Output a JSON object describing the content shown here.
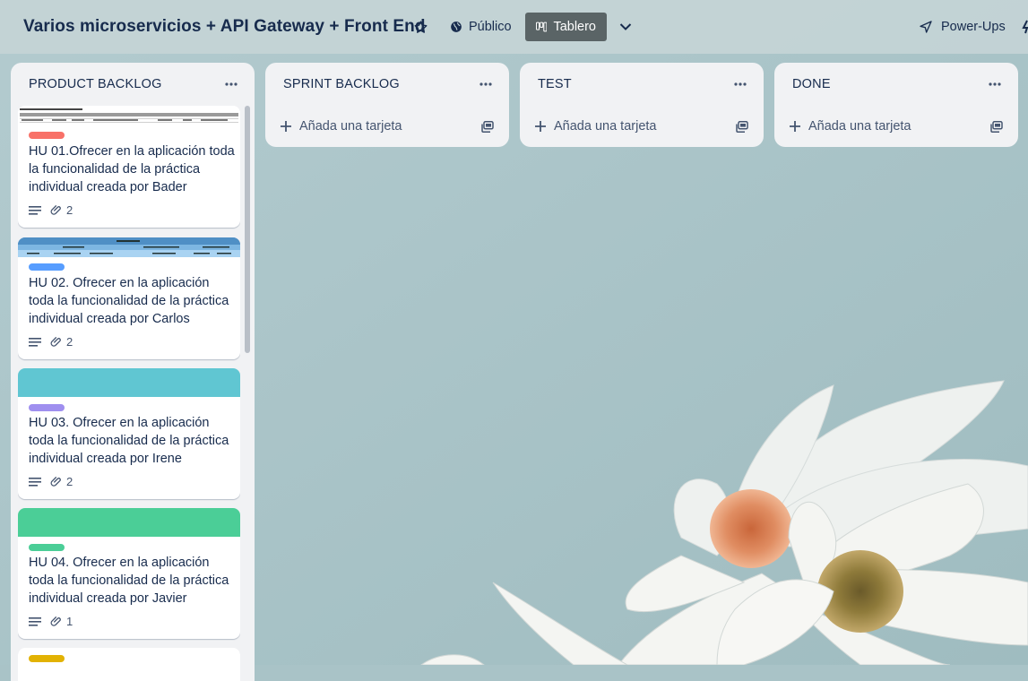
{
  "board": {
    "title": "Varios microservicios + API Gateway + Front End",
    "visibility": "Público",
    "view": "Tablero",
    "powerups": "Power-Ups"
  },
  "icons": {
    "star": "star-icon",
    "visibility": "globe-icon",
    "view": "board-icon",
    "chevron": "chevron-down-icon",
    "powerups": "rocket-icon",
    "menu": "more-icon",
    "add": "plus-icon",
    "template": "card-template-icon",
    "description": "description-icon",
    "attachment": "paperclip-icon"
  },
  "colors": {
    "header_bg": "#c4d4d6",
    "list_bg": "#f1f2f4",
    "view_button_bg": "#5a6466",
    "text": "#172b4d"
  },
  "lists": [
    {
      "title": "PRODUCT BACKLOG",
      "cards": [
        {
          "title": "HU 01.Ofrecer en la aplicación toda la funcionalidad de la práctica individual creada por Bader",
          "label_color": "#f87168",
          "cover": "document",
          "attachments": "2"
        },
        {
          "title": "HU 02. Ofrecer en la aplicación toda la funcionalidad de la práctica individual creada por Carlos",
          "label_color": "#579dff",
          "cover": "spreadsheet",
          "attachments": "2"
        },
        {
          "title": "HU 03. Ofrecer en la aplicación toda la funcionalidad de la práctica individual creada por Irene",
          "label_color": "#9f8fef",
          "cover_color": "#60c6d2",
          "attachments": "2"
        },
        {
          "title": "HU 04. Ofrecer en la aplicación toda la funcionalidad de la práctica individual creada por Javier",
          "label_color": "#4bce97",
          "cover_color": "#4bce97",
          "attachments": "1"
        },
        {
          "title": "",
          "label_color": "#e2b203"
        }
      ]
    },
    {
      "title": "SPRINT BACKLOG",
      "add_card": "Añada una tarjeta"
    },
    {
      "title": "TEST",
      "add_card": "Añada una tarjeta"
    },
    {
      "title": "DONE",
      "add_card": "Añada una tarjeta"
    }
  ]
}
